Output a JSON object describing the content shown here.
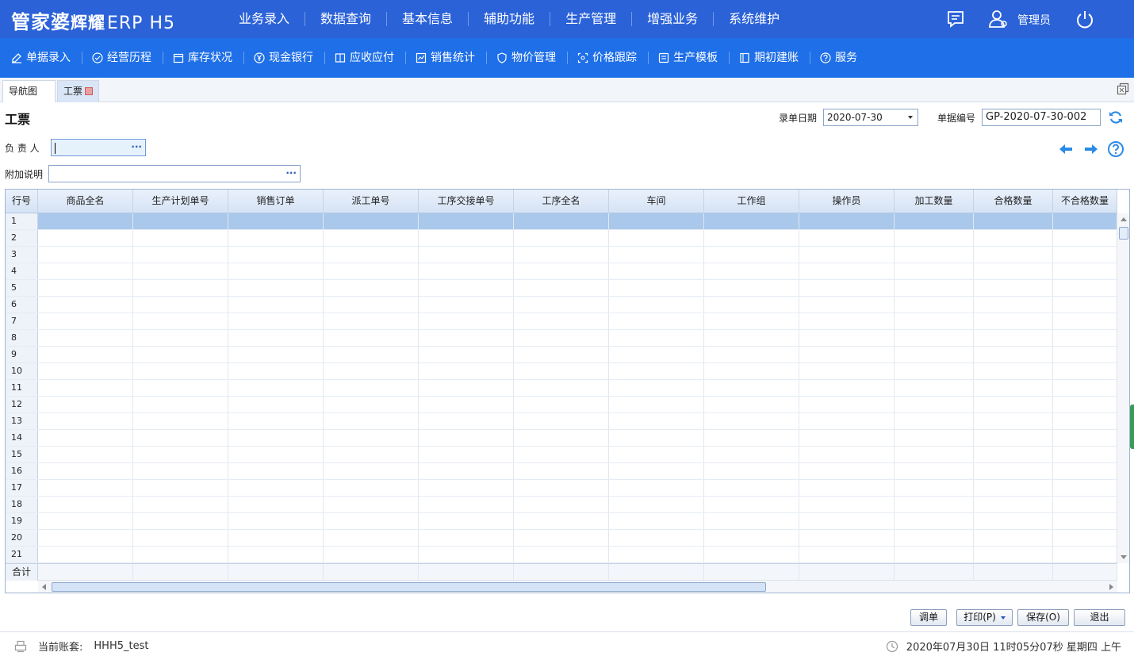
{
  "header": {
    "logo_main": "管家婆",
    "logo_sub": "辉耀",
    "logo_tail": "ERP H5",
    "nav": [
      "业务录入",
      "数据查询",
      "基本信息",
      "辅助功能",
      "生产管理",
      "增强业务",
      "系统维护"
    ],
    "user_label": "管理员",
    "icons": [
      "message-icon",
      "user-icon",
      "power-icon"
    ]
  },
  "toolbar": {
    "items": [
      {
        "label": "单据录入",
        "icon": "edit-icon"
      },
      {
        "label": "经营历程",
        "icon": "check-circle-icon"
      },
      {
        "label": "库存状况",
        "icon": "inventory-icon"
      },
      {
        "label": "现金银行",
        "icon": "yuan-icon"
      },
      {
        "label": "应收应付",
        "icon": "ledger-icon"
      },
      {
        "label": "销售统计",
        "icon": "sales-icon"
      },
      {
        "label": "物价管理",
        "icon": "shield-icon"
      },
      {
        "label": "价格跟踪",
        "icon": "track-icon"
      },
      {
        "label": "生产模板",
        "icon": "template-icon"
      },
      {
        "label": "期初建账",
        "icon": "book-icon"
      },
      {
        "label": "服务",
        "icon": "help-icon"
      }
    ]
  },
  "tabs": [
    {
      "label": "导航图"
    },
    {
      "label": "工票"
    }
  ],
  "form": {
    "title": "工票",
    "date_label": "录单日期",
    "date_value": "2020-07-30",
    "no_label": "单据编号",
    "no_value": "GP-2020-07-30-002",
    "owner_label": "负 责 人",
    "owner_value": "",
    "note_label": "附加说明",
    "note_value": "",
    "dots": "···"
  },
  "grid": {
    "columns": [
      "行号",
      "商品全名",
      "生产计划单号",
      "销售订单",
      "派工单号",
      "工序交接单号",
      "工序全名",
      "车间",
      "工作组",
      "操作员",
      "加工数量",
      "合格数量",
      "不合格数量"
    ],
    "row_numbers": [
      "1",
      "2",
      "3",
      "4",
      "5",
      "6",
      "7",
      "8",
      "9",
      "10",
      "11",
      "12",
      "13",
      "14",
      "15",
      "16",
      "17",
      "18",
      "19",
      "20",
      "21"
    ],
    "sum_label": "合计"
  },
  "buttons": {
    "adjust": "调单",
    "print": "打印(P)",
    "save": "保存(O)",
    "exit": "退出"
  },
  "status": {
    "account_label": "当前账套:",
    "account_value": "HHH5_test",
    "datetime": "2020年07月30日 11时05分07秒 星期四 上午"
  },
  "colors": {
    "header_bg": "#2b62d8",
    "toolbar_bg": "#1e6fe8",
    "selected_row": "#a9c8ec",
    "accent_icon": "#2b8ae6"
  }
}
